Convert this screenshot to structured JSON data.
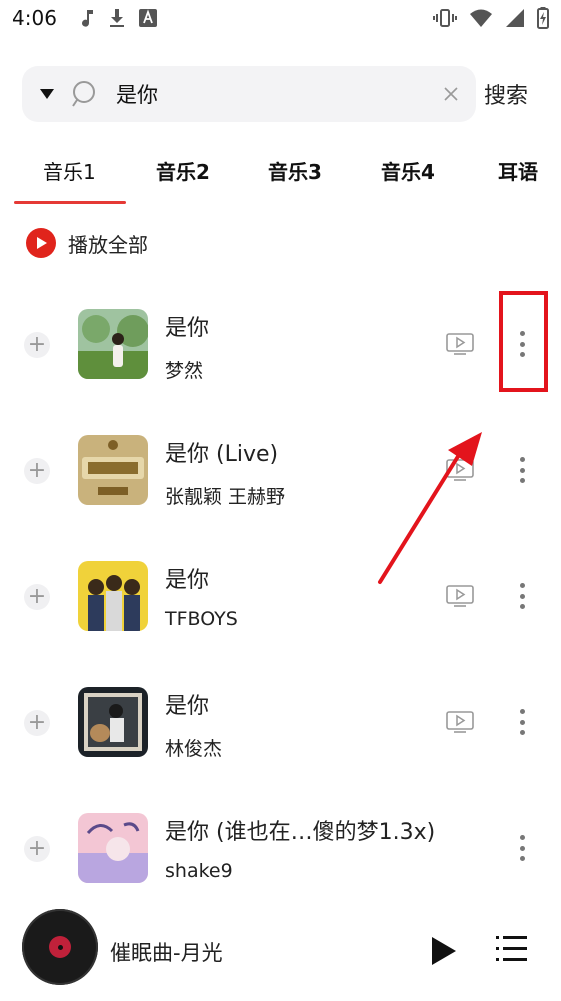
{
  "status_bar": {
    "time": "4:06",
    "left_icons": [
      "music-note-icon",
      "download-icon",
      "font-icon"
    ],
    "right_icons": [
      "vibrate-icon",
      "wifi-icon",
      "signal-icon",
      "battery-icon"
    ]
  },
  "search": {
    "value": "是你",
    "submit_label": "搜索"
  },
  "tabs": [
    {
      "label": "音乐1",
      "active": true
    },
    {
      "label": "音乐2",
      "active": false
    },
    {
      "label": "音乐3",
      "active": false
    },
    {
      "label": "音乐4",
      "active": false
    },
    {
      "label": "耳语",
      "active": false
    }
  ],
  "play_all_label": "播放全部",
  "songs": [
    {
      "title": "是你",
      "artist": "梦然",
      "has_mv": true
    },
    {
      "title": "是你 (Live)",
      "artist": "张靓颖 王赫野",
      "has_mv": true
    },
    {
      "title": "是你",
      "artist": "TFBOYS",
      "has_mv": true
    },
    {
      "title": "是你",
      "artist": "林俊杰",
      "has_mv": true
    },
    {
      "title": "是你 (谁也在…傻的梦1.3x)",
      "artist": "shake9",
      "has_mv": false
    }
  ],
  "player": {
    "now_playing": "催眠曲-月光"
  },
  "colors": {
    "accent": "#e0241c",
    "annotation": "#e3141c"
  }
}
